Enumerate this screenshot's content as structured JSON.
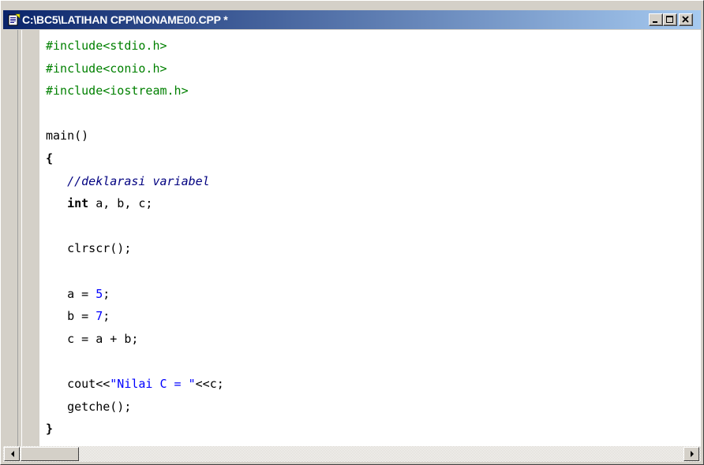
{
  "window": {
    "title": "C:\\BC5\\LATIHAN CPP\\NONAME00.CPP *",
    "icon": "source-file-icon",
    "title_gradient": [
      "#0a246a",
      "#a6caf0"
    ]
  },
  "title_buttons": {
    "minimize": "minimize-icon",
    "maximize": "maximize-icon",
    "close": "close-icon"
  },
  "code_lines": [
    [
      {
        "t": "#include<stdio.h>",
        "c": "pp"
      }
    ],
    [
      {
        "t": "#include<conio.h>",
        "c": "pp"
      }
    ],
    [
      {
        "t": "#include<iostream.h>",
        "c": "pp"
      }
    ],
    [],
    [
      {
        "t": "main()",
        "c": ""
      }
    ],
    [
      {
        "t": "{",
        "c": "kw"
      }
    ],
    [
      {
        "t": "   ",
        "c": ""
      },
      {
        "t": "//deklarasi variabel",
        "c": "cmt"
      }
    ],
    [
      {
        "t": "   ",
        "c": ""
      },
      {
        "t": "int",
        "c": "kw"
      },
      {
        "t": " a, b, c;",
        "c": ""
      }
    ],
    [],
    [
      {
        "t": "   clrscr();",
        "c": ""
      }
    ],
    [],
    [
      {
        "t": "   a = ",
        "c": ""
      },
      {
        "t": "5",
        "c": "num"
      },
      {
        "t": ";",
        "c": ""
      }
    ],
    [
      {
        "t": "   b = ",
        "c": ""
      },
      {
        "t": "7",
        "c": "num"
      },
      {
        "t": ";",
        "c": ""
      }
    ],
    [
      {
        "t": "   c = a + b;",
        "c": ""
      }
    ],
    [],
    [
      {
        "t": "   cout<<",
        "c": ""
      },
      {
        "t": "\"Nilai C = \"",
        "c": "str"
      },
      {
        "t": "<<c;",
        "c": ""
      }
    ],
    [
      {
        "t": "   getche();",
        "c": ""
      }
    ],
    [
      {
        "t": "}",
        "c": "kw"
      }
    ]
  ],
  "syntax_colors": {
    "preprocessor": "#008000",
    "comment": "#000080",
    "number": "#0000ff",
    "string": "#0000ff",
    "text": "#000000"
  },
  "scrollbar": {
    "left_arrow": "arrow-left-icon",
    "right_arrow": "arrow-right-icon"
  }
}
